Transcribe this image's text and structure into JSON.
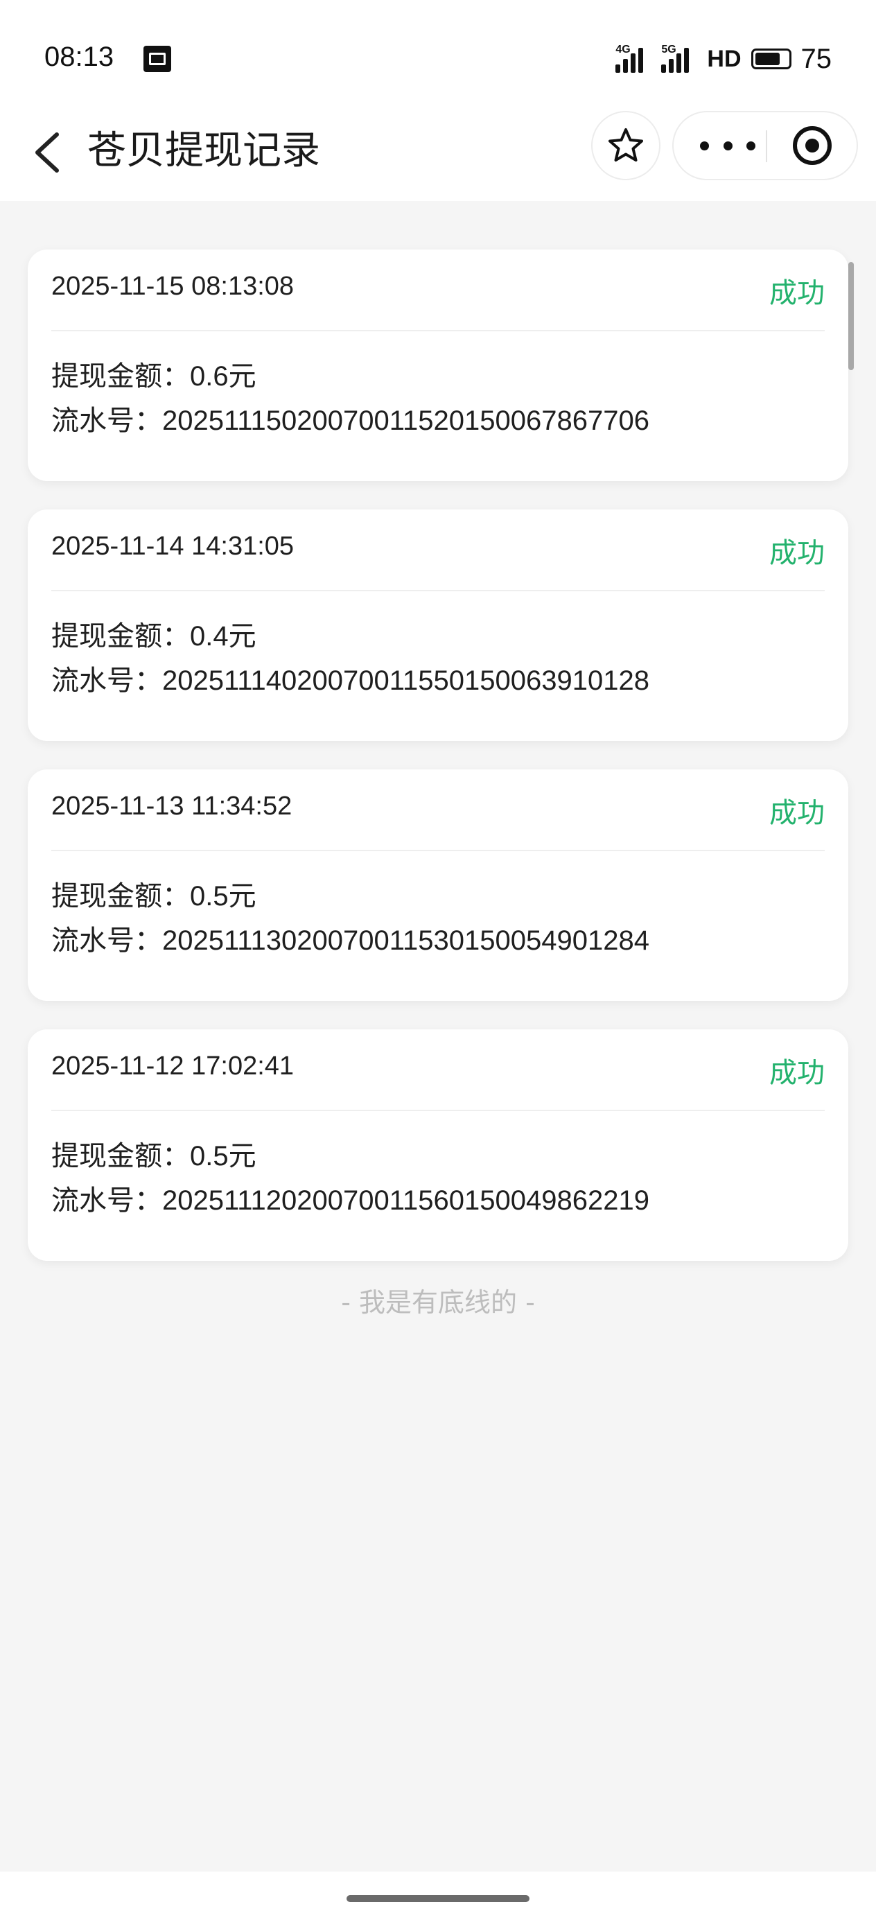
{
  "status_bar": {
    "time": "08:13",
    "signal_1_label": "4G",
    "signal_2_label": "5G",
    "hd_label": "HD",
    "battery_percent": 75,
    "battery_text": "75"
  },
  "nav": {
    "title": "苍贝提现记录"
  },
  "records": [
    {
      "time": "2025-11-15 08:13:08",
      "status": "成功",
      "amount_label": "提现金额：",
      "amount_value": "0.6元",
      "serial_label": "流水号：",
      "serial_value": "202511150200700115201500678677​06"
    },
    {
      "time": "2025-11-14 14:31:05",
      "status": "成功",
      "amount_label": "提现金额：",
      "amount_value": "0.4元",
      "serial_label": "流水号：",
      "serial_value": "20251114020070011550150063910128"
    },
    {
      "time": "2025-11-13 11:34:52",
      "status": "成功",
      "amount_label": "提现金额：",
      "amount_value": "0.5元",
      "serial_label": "流水号：",
      "serial_value": "20251113020070011530150054901284"
    },
    {
      "time": "2025-11-12 17:02:41",
      "status": "成功",
      "amount_label": "提现金额：",
      "amount_value": "0.5元",
      "serial_label": "流水号：",
      "serial_value": "20251112020070011560150049862219"
    }
  ],
  "footer": {
    "text": "- 我是有底线的 -"
  },
  "colors": {
    "success": "#23b26d",
    "background": "#f5f5f5"
  },
  "icons": [
    "back-arrow-icon",
    "star-icon",
    "more-icon",
    "target-icon"
  ]
}
